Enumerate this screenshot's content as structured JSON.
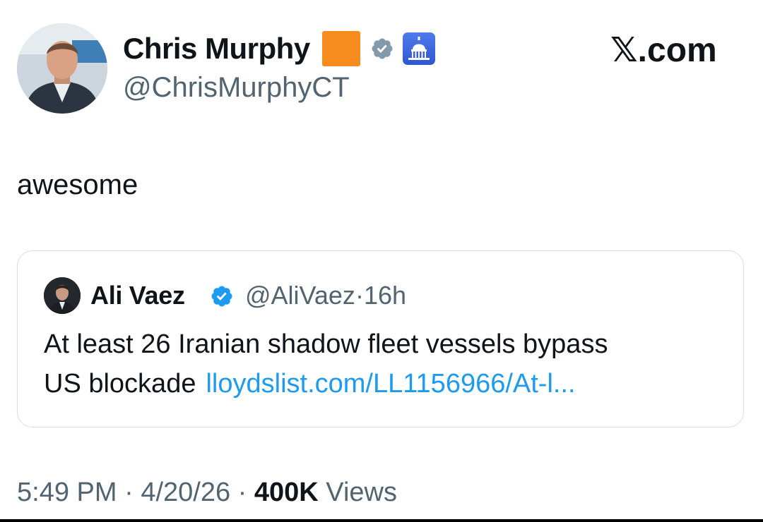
{
  "author": {
    "name": "Chris Murphy",
    "handle": "@ChrisMurphyCT",
    "badges": [
      "orange-square-emoji",
      "gray-verified-icon",
      "capitol-building-icon"
    ]
  },
  "site_label": "𝕏.com",
  "tweet": {
    "text": "awesome"
  },
  "quoted_tweet": {
    "author_name": "Ali Vaez",
    "verified_badge": "blue-verified-icon",
    "handle": "@AliVaez",
    "separator": "·",
    "age": "16h",
    "text_line1": "At least 26 Iranian shadow fleet vessels bypass",
    "text_line2": "US blockade",
    "link_text": "lloydslist.com/LL1156966/At-l..."
  },
  "meta": {
    "time": "5:49 PM",
    "date": "4/20/26",
    "separator": "·",
    "views_count": "400K",
    "views_label": "Views"
  },
  "colors": {
    "text_primary": "#0f1419",
    "text_secondary": "#536471",
    "link": "#1d9bf0",
    "verified_blue": "#1d9bf0",
    "verified_gray": "#829aab",
    "orange_square": "#f78c1e",
    "card_border": "#d9dee2"
  }
}
